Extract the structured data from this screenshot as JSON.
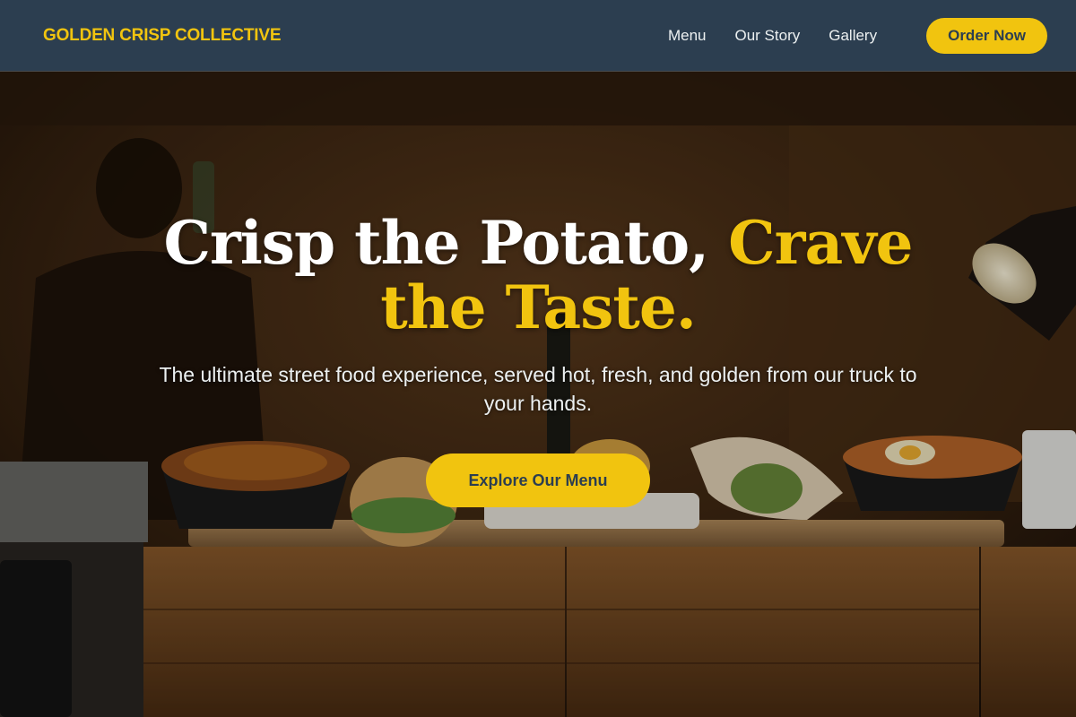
{
  "nav": {
    "brand": "GOLDEN CRISP COLLECTIVE",
    "links": [
      "Menu",
      "Our Story",
      "Gallery"
    ],
    "cta": "Order Now"
  },
  "hero": {
    "headline_white": "Crisp the Potato, ",
    "headline_accent": "Crave the Taste.",
    "subtext": "The ultimate street food experience, served hot, fresh, and golden from our truck to your hands.",
    "cta": "Explore Our Menu"
  },
  "colors": {
    "nav_bg": "#2c3e50",
    "accent": "#f1c40f",
    "text_light": "#ecf0f1"
  }
}
